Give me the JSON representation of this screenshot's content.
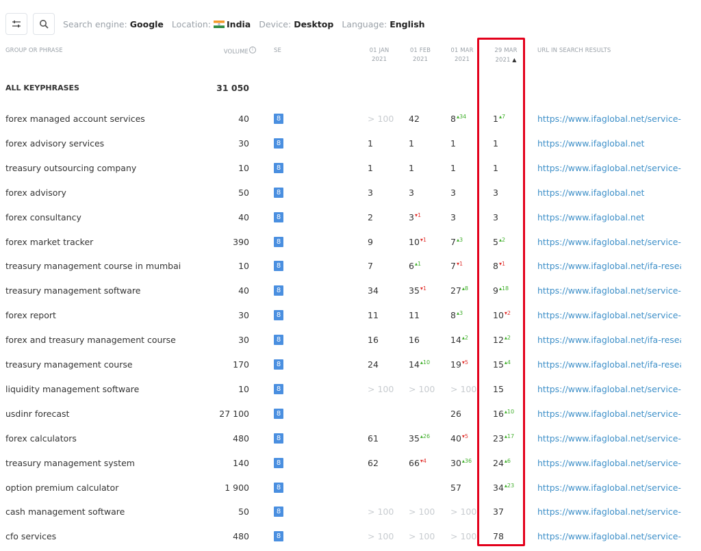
{
  "toolbar": {
    "filters": [
      {
        "label": "Search engine:",
        "value": "Google"
      },
      {
        "label": "Location:",
        "value": "India"
      },
      {
        "label": "Device:",
        "value": "Desktop"
      },
      {
        "label": "Language:",
        "value": "English"
      }
    ]
  },
  "headers": {
    "phrase": "GROUP OR PHRASE",
    "volume": "VOLUME",
    "se": "SE",
    "dates": [
      {
        "line1": "01 JAN",
        "line2": "2021"
      },
      {
        "line1": "01 FEB",
        "line2": "2021"
      },
      {
        "line1": "01 MAR",
        "line2": "2021"
      },
      {
        "line1": "29 MAR",
        "line2": "2021"
      }
    ],
    "sort_indicator": "▲",
    "url": "URL IN SEARCH RESULTS"
  },
  "summary": {
    "phrase": "ALL KEYPHRASES",
    "volume": "31 050"
  },
  "se_icon_label": "8",
  "rows": [
    {
      "phrase": "forex managed account services",
      "volume": "40",
      "ranks": [
        {
          "v": "> 100",
          "dim": true
        },
        {
          "v": "42"
        },
        {
          "v": "8",
          "c": "34",
          "d": "up"
        },
        {
          "v": "1",
          "c": "7",
          "d": "up"
        }
      ],
      "url": "https://www.ifaglobal.net/service-of"
    },
    {
      "phrase": "forex advisory services",
      "volume": "30",
      "ranks": [
        {
          "v": "1"
        },
        {
          "v": "1"
        },
        {
          "v": "1"
        },
        {
          "v": "1"
        }
      ],
      "url": "https://www.ifaglobal.net"
    },
    {
      "phrase": "treasury outsourcing company",
      "volume": "10",
      "ranks": [
        {
          "v": "1"
        },
        {
          "v": "1"
        },
        {
          "v": "1"
        },
        {
          "v": "1"
        }
      ],
      "url": "https://www.ifaglobal.net/service-of"
    },
    {
      "phrase": "forex advisory",
      "volume": "50",
      "ranks": [
        {
          "v": "3"
        },
        {
          "v": "3"
        },
        {
          "v": "3"
        },
        {
          "v": "3"
        }
      ],
      "url": "https://www.ifaglobal.net"
    },
    {
      "phrase": "forex consultancy",
      "volume": "40",
      "ranks": [
        {
          "v": "2"
        },
        {
          "v": "3",
          "c": "1",
          "d": "down"
        },
        {
          "v": "3"
        },
        {
          "v": "3"
        }
      ],
      "url": "https://www.ifaglobal.net"
    },
    {
      "phrase": "forex market tracker",
      "volume": "390",
      "ranks": [
        {
          "v": "9"
        },
        {
          "v": "10",
          "c": "1",
          "d": "down"
        },
        {
          "v": "7",
          "c": "3",
          "d": "up"
        },
        {
          "v": "5",
          "c": "2",
          "d": "up"
        }
      ],
      "url": "https://www.ifaglobal.net/service-of"
    },
    {
      "phrase": "treasury management course in mumbai",
      "volume": "10",
      "ranks": [
        {
          "v": "7"
        },
        {
          "v": "6",
          "c": "1",
          "d": "up"
        },
        {
          "v": "7",
          "c": "1",
          "d": "down"
        },
        {
          "v": "8",
          "c": "1",
          "d": "down"
        }
      ],
      "url": "https://www.ifaglobal.net/ifa-researc"
    },
    {
      "phrase": "treasury management software",
      "volume": "40",
      "ranks": [
        {
          "v": "34"
        },
        {
          "v": "35",
          "c": "1",
          "d": "down"
        },
        {
          "v": "27",
          "c": "8",
          "d": "up"
        },
        {
          "v": "9",
          "c": "18",
          "d": "up"
        }
      ],
      "url": "https://www.ifaglobal.net/service-of"
    },
    {
      "phrase": "forex report",
      "volume": "30",
      "ranks": [
        {
          "v": "11"
        },
        {
          "v": "11"
        },
        {
          "v": "8",
          "c": "3",
          "d": "up"
        },
        {
          "v": "10",
          "c": "2",
          "d": "down"
        }
      ],
      "url": "https://www.ifaglobal.net/service-of"
    },
    {
      "phrase": "forex and treasury management course",
      "volume": "30",
      "ranks": [
        {
          "v": "16"
        },
        {
          "v": "16"
        },
        {
          "v": "14",
          "c": "2",
          "d": "up"
        },
        {
          "v": "12",
          "c": "2",
          "d": "up"
        }
      ],
      "url": "https://www.ifaglobal.net/ifa-researc"
    },
    {
      "phrase": "treasury management course",
      "volume": "170",
      "ranks": [
        {
          "v": "24"
        },
        {
          "v": "14",
          "c": "10",
          "d": "up"
        },
        {
          "v": "19",
          "c": "5",
          "d": "down"
        },
        {
          "v": "15",
          "c": "4",
          "d": "up"
        }
      ],
      "url": "https://www.ifaglobal.net/ifa-researc"
    },
    {
      "phrase": "liquidity management software",
      "volume": "10",
      "ranks": [
        {
          "v": "> 100",
          "dim": true
        },
        {
          "v": "> 100",
          "dim": true
        },
        {
          "v": "> 100",
          "dim": true
        },
        {
          "v": "15"
        }
      ],
      "url": "https://www.ifaglobal.net/service-of"
    },
    {
      "phrase": "usdinr forecast",
      "volume": "27 100",
      "ranks": [
        {
          "v": ""
        },
        {
          "v": ""
        },
        {
          "v": "26"
        },
        {
          "v": "16",
          "c": "10",
          "d": "up"
        }
      ],
      "url": "https://www.ifaglobal.net/service-of"
    },
    {
      "phrase": "forex calculators",
      "volume": "480",
      "ranks": [
        {
          "v": "61"
        },
        {
          "v": "35",
          "c": "26",
          "d": "up"
        },
        {
          "v": "40",
          "c": "5",
          "d": "down"
        },
        {
          "v": "23",
          "c": "17",
          "d": "up"
        }
      ],
      "url": "https://www.ifaglobal.net/service-of"
    },
    {
      "phrase": "treasury management system",
      "volume": "140",
      "ranks": [
        {
          "v": "62"
        },
        {
          "v": "66",
          "c": "4",
          "d": "down"
        },
        {
          "v": "30",
          "c": "36",
          "d": "up"
        },
        {
          "v": "24",
          "c": "6",
          "d": "up"
        }
      ],
      "url": "https://www.ifaglobal.net/service-of"
    },
    {
      "phrase": "option premium calculator",
      "volume": "1 900",
      "ranks": [
        {
          "v": ""
        },
        {
          "v": ""
        },
        {
          "v": "57"
        },
        {
          "v": "34",
          "c": "23",
          "d": "up"
        }
      ],
      "url": "https://www.ifaglobal.net/service-of"
    },
    {
      "phrase": "cash management software",
      "volume": "50",
      "ranks": [
        {
          "v": "> 100",
          "dim": true
        },
        {
          "v": "> 100",
          "dim": true
        },
        {
          "v": "> 100",
          "dim": true
        },
        {
          "v": "37"
        }
      ],
      "url": "https://www.ifaglobal.net/service-of"
    },
    {
      "phrase": "cfo services",
      "volume": "480",
      "ranks": [
        {
          "v": "> 100",
          "dim": true
        },
        {
          "v": "> 100",
          "dim": true
        },
        {
          "v": "> 100",
          "dim": true
        },
        {
          "v": "78"
        }
      ],
      "url": "https://www.ifaglobal.net/service-of"
    }
  ],
  "colors": {
    "up": "#3fae2a",
    "down": "#e0302c",
    "link": "#3d8fc8",
    "se_badge": "#4a8fe0",
    "highlight": "#e3001b"
  }
}
